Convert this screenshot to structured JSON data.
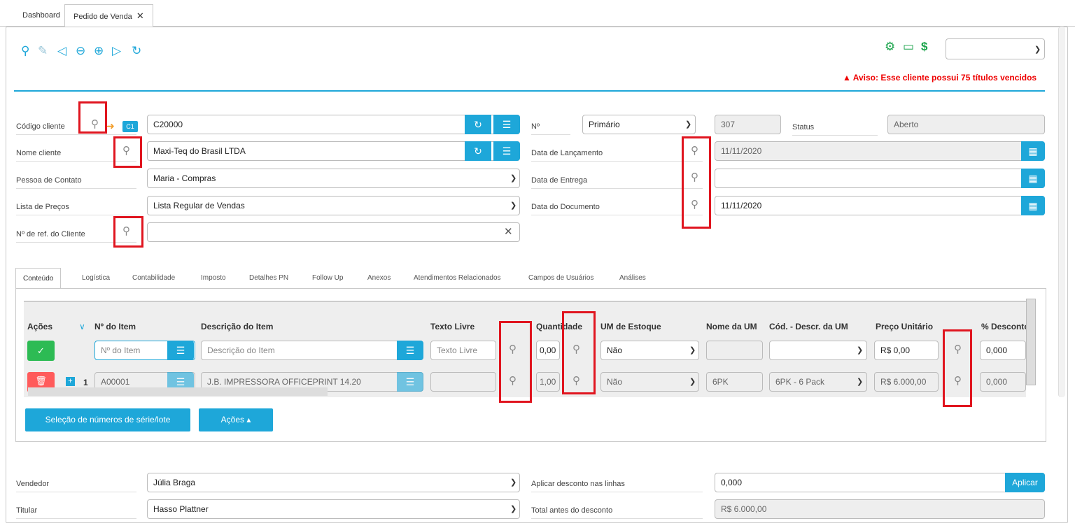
{
  "tabs": [
    {
      "label": "Dashboard"
    },
    {
      "label": "Pedido de Venda"
    }
  ],
  "toolbar": {
    "icons": [
      "search-icon",
      "edit-icon",
      "first-icon",
      "prev-icon",
      "next-icon",
      "last-icon",
      "refresh-icon"
    ],
    "right_icons": [
      "gear-icon",
      "folder-icon",
      "dollar-icon"
    ],
    "select_value": ""
  },
  "warning": "Aviso: Esse cliente possui 75 títulos vencidos",
  "header": {
    "codigo_cliente_label": "Código cliente",
    "codigo_cliente_badge": "C1",
    "codigo_cliente_value": "C20000",
    "nome_cliente_label": "Nome cliente",
    "nome_cliente_value": "Maxi-Teq do Brasil LTDA",
    "pessoa_contato_label": "Pessoa de Contato",
    "pessoa_contato_value": "Maria - Compras",
    "lista_precos_label": "Lista de Preços",
    "lista_precos_value": "Lista Regular de Vendas",
    "ref_cliente_label": "Nº de ref. do Cliente",
    "ref_cliente_value": "",
    "numero_label": "Nº",
    "numero_series": "Primário",
    "numero_value": "307",
    "status_label": "Status",
    "status_value": "Aberto",
    "data_lancamento_label": "Data de Lançamento",
    "data_lancamento_value": "11/11/2020",
    "data_entrega_label": "Data de Entrega",
    "data_entrega_value": "",
    "data_documento_label": "Data do Documento",
    "data_documento_value": "11/11/2020"
  },
  "content_tabs": [
    "Conteúdo",
    "Logística",
    "Contabilidade",
    "Imposto",
    "Detalhes PN",
    "Follow Up",
    "Anexos",
    "Atendimentos Relacionados",
    "Campos de Usuários",
    "Análises"
  ],
  "grid": {
    "headers": [
      "Ações",
      "Nº do Item",
      "Descrição do Item",
      "Texto Livre",
      "Quantidade",
      "UM de Estoque",
      "Nome da UM",
      "Cód. - Descr. da UM",
      "Preço Unitário",
      "% Desconto"
    ],
    "new_row": {
      "item_placeholder": "Nº do Item",
      "desc_placeholder": "Descrição do Item",
      "texto_placeholder": "Texto Livre",
      "quantidade": "0,00",
      "um_estoque": "Não",
      "nome_um": "",
      "cod_um": "",
      "preco": "R$ 0,00",
      "desconto": "0,000"
    },
    "row1": {
      "num": "1",
      "item": "A00001",
      "descricao": "J.B. IMPRESSORA OFFICEPRINT 14.20",
      "texto": "",
      "quantidade": "1,00",
      "um_estoque": "Não",
      "nome_um": "6PK",
      "cod_um": "6PK - 6 Pack",
      "preco": "R$ 6.000,00",
      "desconto": "0,000"
    }
  },
  "buttons": {
    "serie_lote": "Seleção de números de série/lote",
    "acoes": "Ações ▴",
    "aplicar": "Aplicar"
  },
  "footer": {
    "vendedor_label": "Vendedor",
    "vendedor_value": "Júlia Braga",
    "titular_label": "Titular",
    "titular_value": "Hasso Plattner",
    "aplicar_desconto_label": "Aplicar desconto nas linhas",
    "aplicar_desconto_value": "0,000",
    "total_antes_label": "Total antes do desconto",
    "total_antes_value": "R$ 6.000,00"
  },
  "colors": {
    "accent": "#1ea7d9",
    "highlight": "#e0151f",
    "success": "#2dbb54",
    "danger": "#ff5b5b"
  }
}
